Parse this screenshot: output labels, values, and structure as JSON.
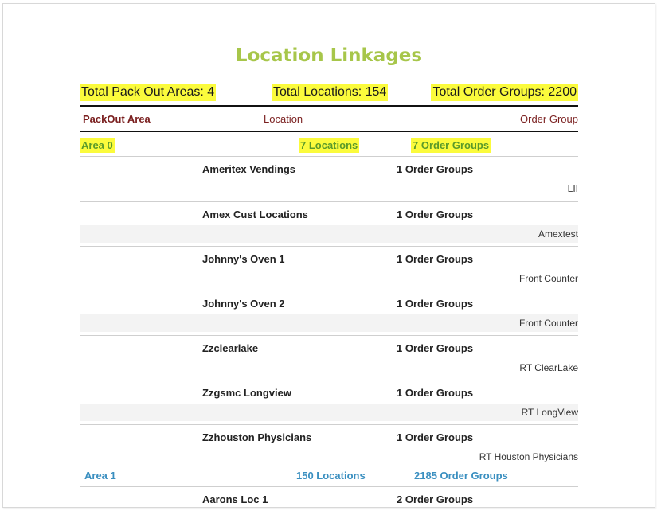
{
  "report": {
    "title": "Location Linkages",
    "totals": {
      "packout_areas": "Total Pack Out Areas: 4",
      "locations": "Total Locations: 154",
      "order_groups": "Total Order Groups: 2200"
    },
    "columns": {
      "packout_area": "PackOut Area",
      "location": "Location",
      "order_group": "Order Group"
    },
    "areas": [
      {
        "name": "Area 0",
        "locations": "7 Locations",
        "order_groups": "7 Order Groups",
        "rows": [
          {
            "location": "Ameritex Vendings",
            "count": "1 Order Groups",
            "order_group": "LII"
          },
          {
            "location": "Amex Cust Locations",
            "count": "1 Order Groups",
            "order_group": "Amextest"
          },
          {
            "location": "Johnny's Oven 1",
            "count": "1 Order Groups",
            "order_group": "Front Counter"
          },
          {
            "location": "Johnny's Oven 2",
            "count": "1 Order Groups",
            "order_group": "Front Counter"
          },
          {
            "location": "Zzclearlake",
            "count": "1 Order Groups",
            "order_group": "RT ClearLake"
          },
          {
            "location": "Zzgsmc Longview",
            "count": "1 Order Groups",
            "order_group": "RT LongView"
          },
          {
            "location": "Zzhouston Physicians",
            "count": "1 Order Groups",
            "order_group": "RT Houston Physicians"
          }
        ]
      },
      {
        "name": "Area 1",
        "locations": "150 Locations",
        "order_groups": "2185 Order Groups",
        "rows": [
          {
            "location": "Aarons Loc 1",
            "count": "2 Order Groups"
          }
        ]
      }
    ]
  }
}
